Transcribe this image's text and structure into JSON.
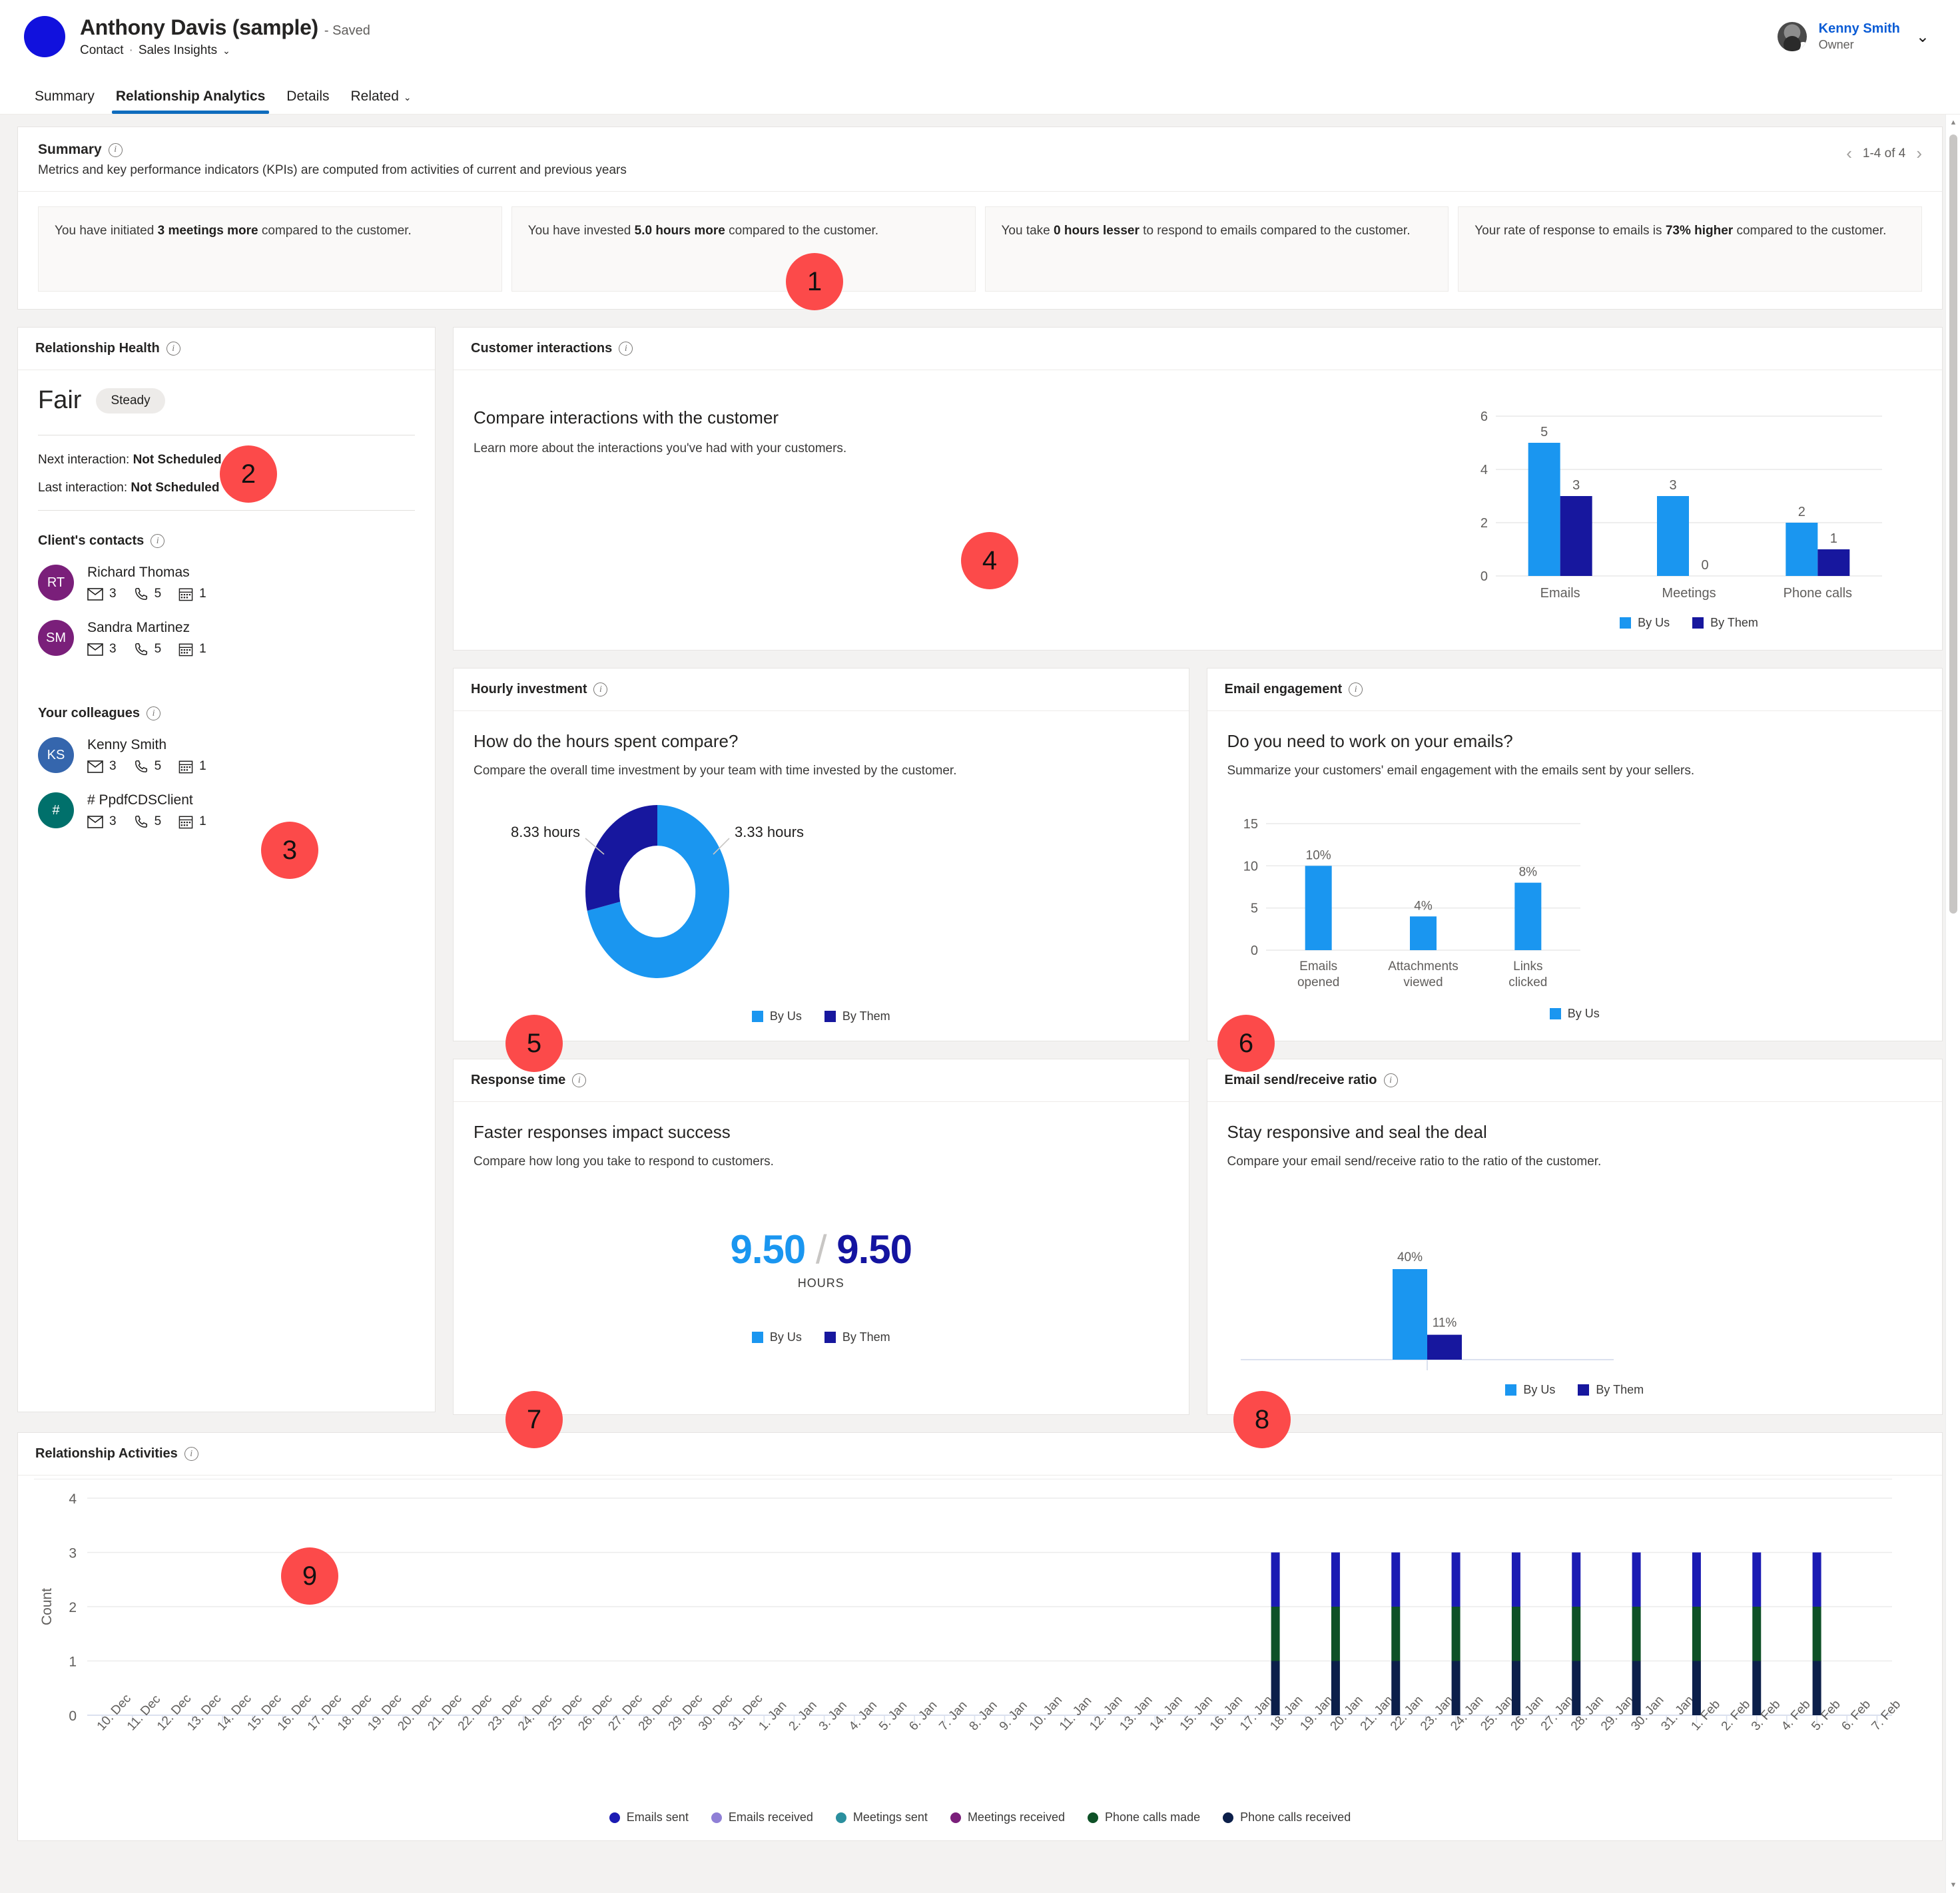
{
  "header": {
    "record_title": "Anthony Davis (sample)",
    "saved_label": "- Saved",
    "entity_type": "Contact",
    "dot": "·",
    "app_name": "Sales Insights",
    "chevron": "⌄",
    "user_name": "Kenny Smith",
    "user_role": "Owner",
    "user_chevron": "⌄"
  },
  "tabs": [
    {
      "label": "Summary",
      "active": false
    },
    {
      "label": "Relationship Analytics",
      "active": true
    },
    {
      "label": "Details",
      "active": false
    },
    {
      "label": "Related",
      "active": false,
      "chevron": "⌄"
    }
  ],
  "summary": {
    "title": "Summary",
    "subtitle": "Metrics and key performance indicators (KPIs) are computed from activities of current and previous years",
    "pager": {
      "prev": "‹",
      "label": "1-4 of 4",
      "next": "›"
    },
    "kpis": [
      {
        "pre": "You have initiated ",
        "strong": "3 meetings more",
        "post": " compared to the customer."
      },
      {
        "pre": "You have invested ",
        "strong": "5.0 hours more",
        "post": " compared to the customer."
      },
      {
        "pre": "You take ",
        "strong": "0 hours lesser",
        "post": " to respond to emails compared to the customer."
      },
      {
        "pre": "Your rate of response to emails is ",
        "strong": "73% higher",
        "post": " compared to the customer."
      }
    ]
  },
  "relationship_health": {
    "title": "Relationship Health",
    "state": "Fair",
    "trend": "Steady",
    "next_interaction_label": "Next interaction:",
    "next_interaction_value": "Not Scheduled",
    "last_interaction_label": "Last interaction:",
    "last_interaction_value": "Not Scheduled",
    "clients_contacts_title": "Client's contacts",
    "colleagues_title": "Your colleagues",
    "clients_contacts": [
      {
        "initials": "RT",
        "name": "Richard Thomas",
        "color": "#7a1f7a",
        "emails": "3",
        "calls": "5",
        "meetings": "1"
      },
      {
        "initials": "SM",
        "name": "Sandra Martinez",
        "color": "#7a1f7a",
        "emails": "3",
        "calls": "5",
        "meetings": "1"
      }
    ],
    "colleagues": [
      {
        "initials": "KS",
        "name": "Kenny Smith",
        "color": "#3566ad",
        "emails": "3",
        "calls": "5",
        "meetings": "1"
      },
      {
        "initials": "#",
        "name": "# PpdfCDSClient",
        "color": "#00706b",
        "emails": "3",
        "calls": "5",
        "meetings": "1"
      }
    ]
  },
  "customer_interactions": {
    "title": "Customer interactions",
    "heading": "Compare interactions with the customer",
    "paragraph": "Learn more about the interactions you've had with your customers."
  },
  "hourly_investment": {
    "title": "Hourly investment",
    "heading": "How do the hours spent compare?",
    "paragraph": "Compare the overall time investment by your team with time invested by the customer."
  },
  "email_engagement": {
    "title": "Email engagement",
    "heading": "Do you need to work on your emails?",
    "paragraph": "Summarize your customers' email engagement with the emails sent by your sellers."
  },
  "response_time": {
    "title": "Response time",
    "heading": "Faster responses impact success",
    "paragraph": "Compare how long you take to respond to customers.",
    "value_us": "9.50",
    "slash": "/",
    "value_them": "9.50",
    "unit": "HOURS"
  },
  "email_ratio": {
    "title": "Email send/receive ratio",
    "heading": "Stay responsive and seal the deal",
    "paragraph": "Compare your email send/receive ratio to the ratio of the customer."
  },
  "relationship_activities": {
    "title": "Relationship Activities"
  },
  "colors": {
    "by_us": "#1a96f0",
    "by_them": "#17179e",
    "emails_sent": "#1b1bb3",
    "emails_received": "#8f7fd6",
    "meetings_sent": "#2a8f9e",
    "meetings_received": "#7a1f7a",
    "phone_calls_made": "#0e5127",
    "phone_calls_received": "#0c1f4a",
    "marker": "#fc4a4a",
    "accent": "#0f6cbd"
  },
  "markers": [
    {
      "n": "1",
      "x": 1180,
      "y": 208
    },
    {
      "n": "2",
      "x": 330,
      "y": 497
    },
    {
      "n": "3",
      "x": 392,
      "y": 1062
    },
    {
      "n": "4",
      "x": 1443,
      "y": 627
    },
    {
      "n": "5",
      "x": 759,
      "y": 1352
    },
    {
      "n": "6",
      "x": 1828,
      "y": 1352
    },
    {
      "n": "7",
      "x": 759,
      "y": 1917
    },
    {
      "n": "8",
      "x": 1852,
      "y": 1917
    },
    {
      "n": "9",
      "x": 422,
      "y": 2152
    }
  ],
  "chart_data": [
    {
      "id": "customer_interactions",
      "type": "bar",
      "title": "",
      "categories": [
        "Emails",
        "Meetings",
        "Phone calls"
      ],
      "series": [
        {
          "name": "By Us",
          "color": "#1a96f0",
          "values": [
            5,
            3,
            2
          ]
        },
        {
          "name": "By Them",
          "color": "#17179e",
          "values": [
            3,
            0,
            1
          ]
        }
      ],
      "yticks": [
        0,
        2,
        4,
        6
      ],
      "ylim": [
        0,
        6
      ],
      "xlabel": "",
      "ylabel": "",
      "grid": true,
      "legend": [
        "By Us",
        "By Them"
      ],
      "legend_position": "bottom"
    },
    {
      "id": "hourly_investment",
      "type": "pie",
      "title": "",
      "labels": [
        "8.33 hours",
        "3.33 hours"
      ],
      "values": [
        8.33,
        3.33
      ],
      "colors": [
        "#1a96f0",
        "#17179e"
      ],
      "donut": true,
      "legend": [
        "By Us",
        "By Them"
      ],
      "legend_position": "bottom"
    },
    {
      "id": "email_engagement",
      "type": "bar",
      "title": "",
      "categories": [
        "Emails opened",
        "Attachments viewed",
        "Links clicked"
      ],
      "series": [
        {
          "name": "By Us",
          "color": "#1a96f0",
          "values": [
            10,
            4,
            8
          ],
          "labels": [
            "10%",
            "4%",
            "8%"
          ]
        }
      ],
      "yticks": [
        0,
        5,
        10,
        15
      ],
      "ylim": [
        0,
        15
      ],
      "xlabel": "",
      "ylabel": "",
      "grid": true,
      "legend": [
        "By Us"
      ],
      "legend_position": "bottom"
    },
    {
      "id": "response_time",
      "type": "table",
      "title": "",
      "categories": [
        "By Us",
        "By Them"
      ],
      "values": [
        9.5,
        9.5
      ],
      "unit": "HOURS",
      "legend": [
        "By Us",
        "By Them"
      ],
      "legend_position": "bottom"
    },
    {
      "id": "email_send_receive_ratio",
      "type": "bar",
      "title": "",
      "categories": [
        ""
      ],
      "series": [
        {
          "name": "By Us",
          "color": "#1a96f0",
          "values": [
            40
          ],
          "labels": [
            "40%"
          ]
        },
        {
          "name": "By Them",
          "color": "#17179e",
          "values": [
            11
          ],
          "labels": [
            "11%"
          ]
        }
      ],
      "ylim": [
        0,
        50
      ],
      "xlabel": "",
      "ylabel": "",
      "grid": false,
      "legend": [
        "By Us",
        "By Them"
      ],
      "legend_position": "bottom"
    },
    {
      "id": "relationship_activities",
      "type": "bar",
      "stacked": true,
      "title": "Relationship Activities",
      "xlabel": "",
      "ylabel": "Count",
      "yticks": [
        0,
        1,
        2,
        3,
        4
      ],
      "ylim": [
        0,
        4
      ],
      "grid": true,
      "categories": [
        "10. Dec",
        "11. Dec",
        "12. Dec",
        "13. Dec",
        "14. Dec",
        "15. Dec",
        "16. Dec",
        "17. Dec",
        "18. Dec",
        "19. Dec",
        "20. Dec",
        "21. Dec",
        "22. Dec",
        "23. Dec",
        "24. Dec",
        "25. Dec",
        "26. Dec",
        "27. Dec",
        "28. Dec",
        "29. Dec",
        "30. Dec",
        "31. Dec",
        "1. Jan",
        "2. Jan",
        "3. Jan",
        "4. Jan",
        "5. Jan",
        "6. Jan",
        "7. Jan",
        "8. Jan",
        "9. Jan",
        "10. Jan",
        "11. Jan",
        "12. Jan",
        "13. Jan",
        "14. Jan",
        "15. Jan",
        "16. Jan",
        "17. Jan",
        "18. Jan",
        "19. Jan",
        "20. Jan",
        "21. Jan",
        "22. Jan",
        "23. Jan",
        "24. Jan",
        "25. Jan",
        "26. Jan",
        "27. Jan",
        "28. Jan",
        "29. Jan",
        "30. Jan",
        "31. Jan",
        "1. Feb",
        "2. Feb",
        "3. Feb",
        "4. Feb",
        "5. Feb",
        "6. Feb",
        "7. Feb"
      ],
      "series": [
        {
          "name": "Emails sent",
          "color": "#1b1bb3",
          "values": [
            0,
            0,
            0,
            0,
            0,
            0,
            0,
            0,
            0,
            0,
            0,
            0,
            0,
            0,
            0,
            0,
            0,
            0,
            0,
            0,
            0,
            0,
            0,
            0,
            0,
            0,
            0,
            0,
            0,
            0,
            0,
            0,
            0,
            0,
            0,
            0,
            0,
            0,
            0,
            1,
            0,
            1,
            0,
            1,
            0,
            1,
            0,
            1,
            0,
            1,
            0,
            1,
            0,
            1,
            0,
            1,
            0,
            1,
            0,
            0
          ]
        },
        {
          "name": "Emails received",
          "color": "#8f7fd6",
          "values": [
            0,
            0,
            0,
            0,
            0,
            0,
            0,
            0,
            0,
            0,
            0,
            0,
            0,
            0,
            0,
            0,
            0,
            0,
            0,
            0,
            0,
            0,
            0,
            0,
            0,
            0,
            0,
            0,
            0,
            0,
            0,
            0,
            0,
            0,
            0,
            0,
            0,
            0,
            0,
            0,
            0,
            0,
            0,
            0,
            0,
            0,
            0,
            0,
            0,
            0,
            0,
            0,
            0,
            0,
            0,
            0,
            0,
            0,
            0,
            0
          ]
        },
        {
          "name": "Meetings sent",
          "color": "#2a8f9e",
          "values": [
            0,
            0,
            0,
            0,
            0,
            0,
            0,
            0,
            0,
            0,
            0,
            0,
            0,
            0,
            0,
            0,
            0,
            0,
            0,
            0,
            0,
            0,
            0,
            0,
            0,
            0,
            0,
            0,
            0,
            0,
            0,
            0,
            0,
            0,
            0,
            0,
            0,
            0,
            0,
            0,
            0,
            0,
            0,
            0,
            0,
            0,
            0,
            0,
            0,
            0,
            0,
            0,
            0,
            0,
            0,
            0,
            0,
            0,
            0,
            0
          ]
        },
        {
          "name": "Meetings received",
          "color": "#7a1f7a",
          "values": [
            0,
            0,
            0,
            0,
            0,
            0,
            0,
            0,
            0,
            0,
            0,
            0,
            0,
            0,
            0,
            0,
            0,
            0,
            0,
            0,
            0,
            0,
            0,
            0,
            0,
            0,
            0,
            0,
            0,
            0,
            0,
            0,
            0,
            0,
            0,
            0,
            0,
            0,
            0,
            0,
            0,
            0,
            0,
            0,
            0,
            0,
            0,
            0,
            0,
            0,
            0,
            0,
            0,
            0,
            0,
            0,
            0,
            0,
            0,
            0
          ]
        },
        {
          "name": "Phone calls made",
          "color": "#0e5127",
          "values": [
            0,
            0,
            0,
            0,
            0,
            0,
            0,
            0,
            0,
            0,
            0,
            0,
            0,
            0,
            0,
            0,
            0,
            0,
            0,
            0,
            0,
            0,
            0,
            0,
            0,
            0,
            0,
            0,
            0,
            0,
            0,
            0,
            0,
            0,
            0,
            0,
            0,
            0,
            0,
            1,
            0,
            1,
            0,
            1,
            0,
            1,
            0,
            1,
            0,
            1,
            0,
            1,
            0,
            1,
            0,
            1,
            0,
            1,
            0,
            0
          ]
        },
        {
          "name": "Phone calls received",
          "color": "#0c1f4a",
          "values": [
            0,
            0,
            0,
            0,
            0,
            0,
            0,
            0,
            0,
            0,
            0,
            0,
            0,
            0,
            0,
            0,
            0,
            0,
            0,
            0,
            0,
            0,
            0,
            0,
            0,
            0,
            0,
            0,
            0,
            0,
            0,
            0,
            0,
            0,
            0,
            0,
            0,
            0,
            0,
            1,
            0,
            1,
            0,
            1,
            0,
            1,
            0,
            1,
            0,
            1,
            0,
            1,
            0,
            1,
            0,
            1,
            0,
            1,
            0,
            0
          ]
        }
      ],
      "legend": [
        "Emails sent",
        "Emails received",
        "Meetings sent",
        "Meetings received",
        "Phone calls made",
        "Phone calls received"
      ],
      "legend_position": "bottom"
    }
  ]
}
